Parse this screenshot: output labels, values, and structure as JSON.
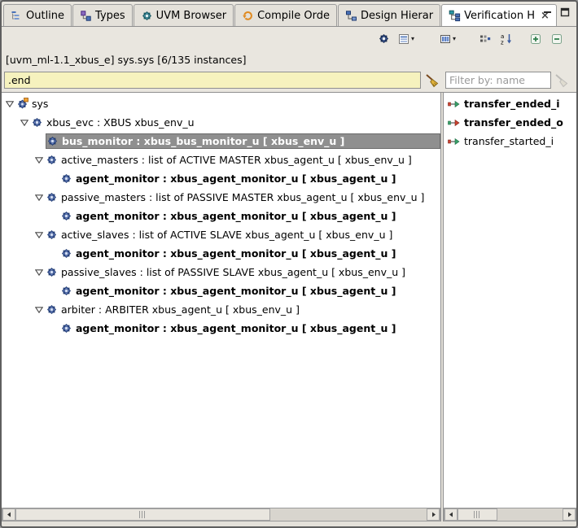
{
  "tabs": [
    {
      "label": "Outline",
      "icon": "outline-tab-icon",
      "active": false
    },
    {
      "label": "Types",
      "icon": "types-tab-icon",
      "active": false
    },
    {
      "label": "UVM Browser",
      "icon": "uvm-browser-tab-icon",
      "active": false
    },
    {
      "label": "Compile Orde",
      "icon": "compile-order-tab-icon",
      "active": false
    },
    {
      "label": "Design Hierar",
      "icon": "design-hierarchy-tab-icon",
      "active": false
    },
    {
      "label": "Verification H",
      "icon": "verification-hierarchy-tab-icon",
      "active": true
    }
  ],
  "window_controls": [
    "minimize-icon",
    "maximize-icon"
  ],
  "toolbar": {
    "buttons": [
      {
        "icon": "settings-gear-icon",
        "dropdown": false,
        "gap_after": 6
      },
      {
        "icon": "view-menu-icon",
        "dropdown": true,
        "gap_after": 30
      },
      {
        "icon": "columns-icon",
        "dropdown": true,
        "gap_after": 26
      },
      {
        "icon": "dots-grid-icon",
        "dropdown": false,
        "gap_after": 6
      },
      {
        "icon": "sort-az-icon",
        "dropdown": false,
        "gap_after": 16
      },
      {
        "icon": "expand-all-icon",
        "dropdown": false,
        "gap_after": 6
      },
      {
        "icon": "collapse-all-icon",
        "dropdown": false,
        "gap_after": 0
      }
    ]
  },
  "header": {
    "instance_label": "[uvm_ml-1.1_xbus_e] sys.sys [6/135 instances]"
  },
  "search": {
    "value": ".end"
  },
  "filter": {
    "placeholder": "Filter by: name"
  },
  "tree": {
    "rows": [
      {
        "level": 0,
        "expander": true,
        "icon": "sys-icon",
        "label": "sys",
        "bold": false,
        "selected": false
      },
      {
        "level": 1,
        "expander": true,
        "icon": "unit-icon",
        "label": "xbus_evc : XBUS xbus_env_u",
        "bold": false,
        "selected": false
      },
      {
        "level": 2,
        "expander": false,
        "icon": "unit-icon",
        "label": "bus_monitor : xbus_bus_monitor_u [ xbus_env_u ]",
        "bold": true,
        "selected": true
      },
      {
        "level": 2,
        "expander": true,
        "icon": "unit-icon",
        "label": "active_masters : list of ACTIVE MASTER xbus_agent_u [ xbus_env_u ]",
        "bold": false,
        "selected": false
      },
      {
        "level": 3,
        "expander": false,
        "icon": "unit-icon",
        "label": "agent_monitor : xbus_agent_monitor_u [ xbus_agent_u ]",
        "bold": true,
        "selected": false
      },
      {
        "level": 2,
        "expander": true,
        "icon": "unit-icon",
        "label": "passive_masters : list of PASSIVE MASTER xbus_agent_u [ xbus_env_u ]",
        "bold": false,
        "selected": false
      },
      {
        "level": 3,
        "expander": false,
        "icon": "unit-icon",
        "label": "agent_monitor : xbus_agent_monitor_u [ xbus_agent_u ]",
        "bold": true,
        "selected": false
      },
      {
        "level": 2,
        "expander": true,
        "icon": "unit-icon",
        "label": "active_slaves : list of ACTIVE SLAVE xbus_agent_u [ xbus_env_u ]",
        "bold": false,
        "selected": false
      },
      {
        "level": 3,
        "expander": false,
        "icon": "unit-icon",
        "label": "agent_monitor : xbus_agent_monitor_u [ xbus_agent_u ]",
        "bold": true,
        "selected": false
      },
      {
        "level": 2,
        "expander": true,
        "icon": "unit-icon",
        "label": "passive_slaves : list of PASSIVE SLAVE xbus_agent_u [ xbus_env_u ]",
        "bold": false,
        "selected": false
      },
      {
        "level": 3,
        "expander": false,
        "icon": "unit-icon",
        "label": "agent_monitor : xbus_agent_monitor_u [ xbus_agent_u ]",
        "bold": true,
        "selected": false
      },
      {
        "level": 2,
        "expander": true,
        "icon": "unit-icon",
        "label": "arbiter : ARBITER xbus_agent_u [ xbus_env_u ]",
        "bold": false,
        "selected": false
      },
      {
        "level": 3,
        "expander": false,
        "icon": "unit-icon",
        "label": "agent_monitor : xbus_agent_monitor_u [ xbus_agent_u ]",
        "bold": true,
        "selected": false
      }
    ]
  },
  "ports": {
    "items": [
      {
        "icon": "event-in-icon",
        "label": "transfer_ended_i",
        "bold": true
      },
      {
        "icon": "event-out-icon",
        "label": "transfer_ended_o",
        "bold": true
      },
      {
        "icon": "event-in-icon",
        "label": "transfer_started_i",
        "bold": false
      }
    ]
  },
  "scrollbars": {
    "left": {
      "thumb_percent": 62
    },
    "right": {
      "thumb_percent": 38
    }
  },
  "colors": {
    "selection_background": "#8f8f8f",
    "selection_text": "#ffffff",
    "search_background": "#f6f2be",
    "panel_background": "#ffffff",
    "chrome_background": "#e9e6df"
  }
}
